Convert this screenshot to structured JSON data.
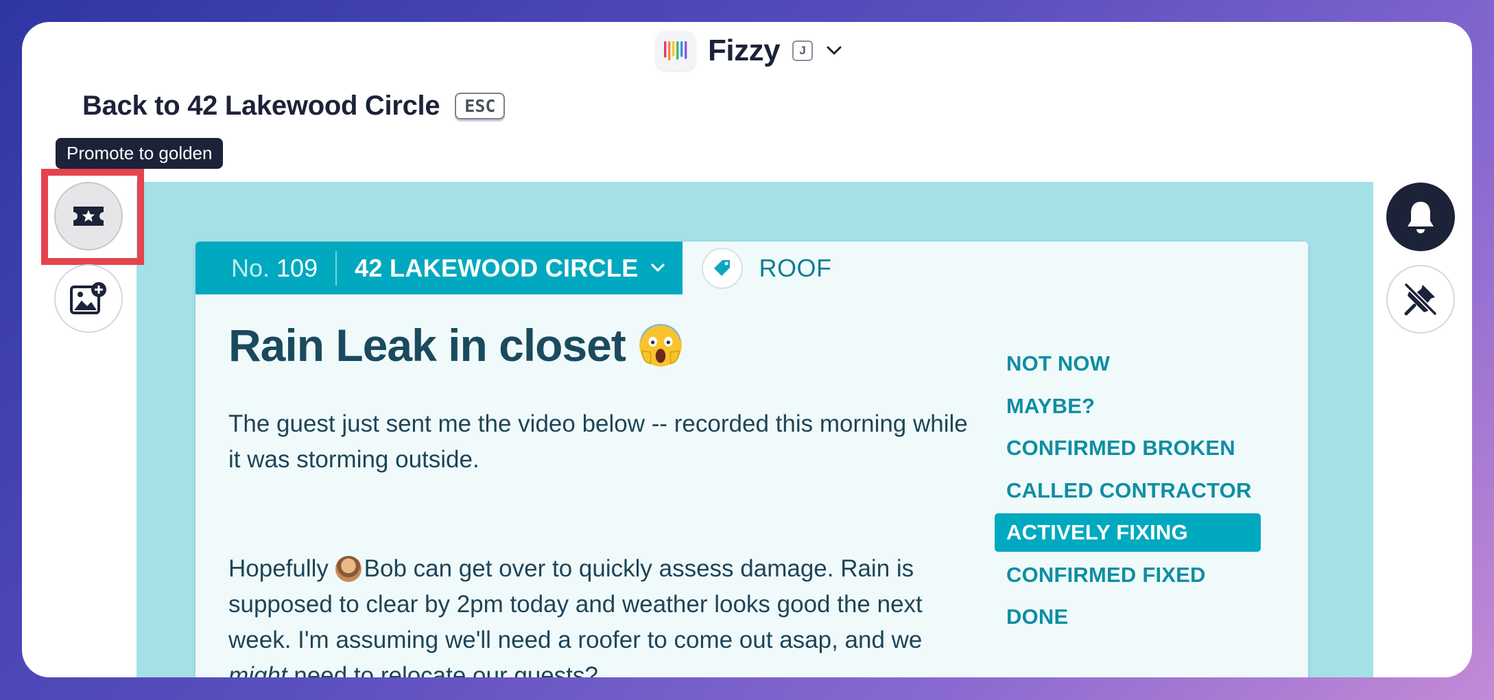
{
  "app": {
    "name": "Fizzy",
    "shortcut": "J"
  },
  "back": {
    "label": "Back to 42 Lakewood Circle",
    "shortcut": "ESC"
  },
  "tooltip": {
    "text": "Promote to golden"
  },
  "left_actions": [
    {
      "icon": "golden-ticket-icon",
      "label": "Promote to golden"
    },
    {
      "icon": "add-image-icon"
    }
  ],
  "right_actions": [
    {
      "icon": "bell-icon"
    },
    {
      "icon": "unpin-icon"
    }
  ],
  "card": {
    "number_label": "No.",
    "number": "109",
    "board": "42 LAKEWOOD CIRCLE",
    "tag": "ROOF",
    "title": "Rain Leak in closet",
    "body_paragraph_1": "The guest just sent me the video below -- recorded this morning while it was storming outside.",
    "body_paragraph_2": {
      "prefix": "Hopefully ",
      "mention": "Bob",
      "middle": " can get over to quickly assess damage. Rain is supposed to clear by 2pm today and weather looks good the next week. I'm assuming we'll need a roofer to come out asap, and we ",
      "emphasis": "might",
      "suffix": " need to relocate our guests?"
    },
    "statuses": [
      {
        "label": "NOT NOW",
        "active": false
      },
      {
        "label": "MAYBE?",
        "active": false
      },
      {
        "label": "CONFIRMED BROKEN",
        "active": false
      },
      {
        "label": "CALLED CONTRACTOR",
        "active": false
      },
      {
        "label": "ACTIVELY FIXING",
        "active": true
      },
      {
        "label": "CONFIRMED FIXED",
        "active": false
      },
      {
        "label": "DONE",
        "active": false
      }
    ]
  },
  "colors": {
    "accent_teal": "#00a9bf",
    "board_background": "#a5e0e7",
    "highlight_red": "#e5434d",
    "text_dark": "#1c2238"
  }
}
